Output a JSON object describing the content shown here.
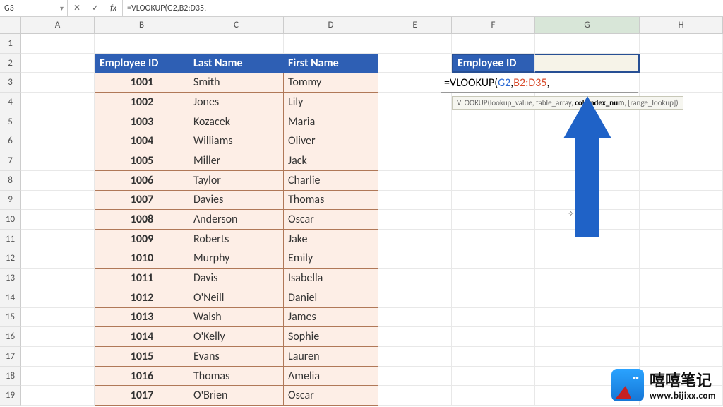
{
  "name_box": "G3",
  "fx_label": "fx",
  "formula_bar": "=VLOOKUP(G2,B2:D35,",
  "columns": [
    "A",
    "B",
    "C",
    "D",
    "E",
    "F",
    "G",
    "H"
  ],
  "active_column": "G",
  "row_count": 19,
  "table": {
    "headers": [
      "Employee ID",
      "Last Name",
      "First Name"
    ],
    "rows": [
      [
        "1001",
        "Smith",
        "Tommy"
      ],
      [
        "1002",
        "Jones",
        "Lily"
      ],
      [
        "1003",
        "Kozacek",
        "Maria"
      ],
      [
        "1004",
        "Williams",
        "Oliver"
      ],
      [
        "1005",
        "Miller",
        "Jack"
      ],
      [
        "1006",
        "Taylor",
        "Charlie"
      ],
      [
        "1007",
        "Davies",
        "Thomas"
      ],
      [
        "1008",
        "Anderson",
        "Oscar"
      ],
      [
        "1009",
        "Roberts",
        "Jake"
      ],
      [
        "1010",
        "Murphy",
        "Emily"
      ],
      [
        "1011",
        "Davis",
        "Isabella"
      ],
      [
        "1012",
        "O'Neill",
        "Daniel"
      ],
      [
        "1013",
        "Walsh",
        "James"
      ],
      [
        "1014",
        "O'Kelly",
        "Sophie"
      ],
      [
        "1015",
        "Evans",
        "Lauren"
      ],
      [
        "1016",
        "Thomas",
        "Amelia"
      ],
      [
        "1017",
        "O'Brien",
        "Oscar"
      ]
    ]
  },
  "lookup": {
    "header": "Employee ID",
    "editing_formula_prefix": "=VLOOKUP(",
    "editing_arg1": "G2",
    "editing_sep1": ",",
    "editing_arg2": "B2:D35",
    "editing_suffix": ","
  },
  "tooltip": {
    "fn": "VLOOKUP(",
    "a1": "lookup_value",
    "s1": ", ",
    "a2": "table_array",
    "s2": ", ",
    "a3": "col_index_num",
    "s3": ", ",
    "a4": "[range_lookup])"
  },
  "watermark": {
    "title": "嘻嘻笔记",
    "url": "www.bijixx.com"
  }
}
